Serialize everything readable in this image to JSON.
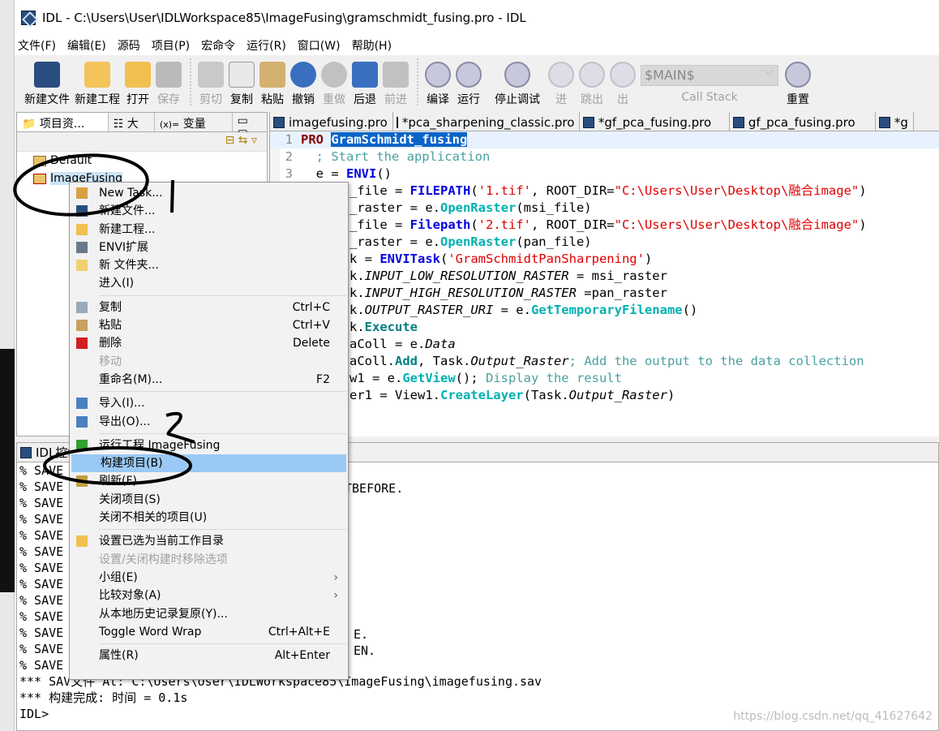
{
  "window": {
    "title": "IDL  -  C:\\Users\\User\\IDLWorkspace85\\ImageFusing\\gramschmidt_fusing.pro  -  IDL"
  },
  "menubar": [
    "文件(F)",
    "编辑(E)",
    "源码",
    "项目(P)",
    "宏命令",
    "运行(R)",
    "窗口(W)",
    "帮助(H)"
  ],
  "toolbar": {
    "new_file": "新建文件",
    "new_project": "新建工程",
    "open": "打开",
    "save": "保存",
    "cut": "剪切",
    "copy": "复制",
    "paste": "粘贴",
    "undo": "撤销",
    "redo": "重做",
    "back": "后退",
    "forward": "前进",
    "compile": "编译",
    "run": "运行",
    "stop_debug": "停止调试",
    "step_into": "进",
    "step_over": "跳出",
    "step_out": "出",
    "call_stack_value": "$MAIN$",
    "call_stack_label": "Call Stack",
    "reset": "重置"
  },
  "left_panel": {
    "tabs": [
      "项目资...",
      "大纲",
      "变量查..."
    ],
    "tree": [
      "Default",
      "ImageFusing"
    ]
  },
  "editor": {
    "tabs": [
      "imagefusing.pro",
      "*pca_sharpening_classic.pro",
      "*gf_pca_fusing.pro",
      "gf_pca_fusing.pro",
      "*g"
    ],
    "line_numbers": [
      "1",
      "2",
      "3"
    ],
    "code": {
      "l1a": "PRO ",
      "l1b": "GramSchmidt_fusing",
      "l2": "  ; Start the application",
      "l3a": "  e = ",
      "l3b": "ENVI",
      "l3c": "()",
      "l4a": "_file = ",
      "l4b": "FILEPATH",
      "l4c": "(",
      "l4d": "'1.tif'",
      "l4e": ", ROOT_DIR=",
      "l4f": "\"C:\\Users\\User\\Desktop\\融合image\"",
      "l4g": ")",
      "l5a": "_raster = e.",
      "l5b": "OpenRaster",
      "l5c": "(msi_file)",
      "l6a": "_file = ",
      "l6b": "Filepath",
      "l6c": "(",
      "l6d": "'2.tif'",
      "l6e": ", ROOT_DIR=",
      "l6f": "\"C:\\Users\\User\\Desktop\\融合image\"",
      "l6g": ")",
      "l7a": "_raster = e.",
      "l7b": "OpenRaster",
      "l7c": "(pan_file)",
      "l8a": "k = ",
      "l8b": "ENVITask",
      "l8c": "(",
      "l8d": "'GramSchmidtPanSharpening'",
      "l8e": ")",
      "l9a": "k.",
      "l9b": "INPUT_LOW_RESOLUTION_RASTER",
      "l9c": " = msi_raster",
      "l10a": "k.",
      "l10b": "INPUT_HIGH_RESOLUTION_RASTER",
      "l10c": " =pan_raster",
      "l11a": "k.",
      "l11b": "OUTPUT_RASTER_URI",
      "l11c": " = e.",
      "l11d": "GetTemporaryFilename",
      "l11e": "()",
      "l12a": "k.",
      "l12b": "Execute",
      "l13a": "aColl = e.",
      "l13b": "Data",
      "l14a": "aColl.",
      "l14b": "Add",
      "l14c": ", Task.",
      "l14d": "Output_Raster",
      "l14e": "; Add the output to the data collection",
      "l15a": "w1 = e.",
      "l15b": "GetView",
      "l15c": "(); ",
      "l15d": "Display the result",
      "l16a": "er1 = View1.",
      "l16b": "CreateLayer",
      "l16c": "(Task.",
      "l16d": "Output_Raster",
      "l16e": ")"
    }
  },
  "console": {
    "tab": "IDL控制台",
    "lines": [
      "% SAVE",
      "% SAVE",
      "% SAVE",
      "% SAVE",
      "% SAVE",
      "% SAVE",
      "% SAVE",
      "% SAVE",
      "% SAVE",
      "% SAVE",
      "% SAVE",
      "% SAVE",
      "% SAVE",
      "*** SAV文件 At: C:\\Users\\User\\IDLWorkspace85\\ImageFusing\\imagefusing.sav",
      "*** 构建完成: 时间 = 0.1s",
      "IDL>"
    ],
    "fragments": {
      "f1": "TBEFORE.",
      "f2": "E.",
      "f3": "EN."
    }
  },
  "context_menu": {
    "items": [
      {
        "label": "New Task...",
        "icon": "new-task-icon"
      },
      {
        "label": "新建文件...",
        "icon": "idl-file-icon"
      },
      {
        "label": "新建工程...",
        "icon": "new-project-icon"
      },
      {
        "label": "ENVI扩展",
        "icon": "envi-extension-icon"
      },
      {
        "label": "新 文件夹...",
        "icon": "new-folder-icon"
      },
      {
        "label": "进入(I)"
      },
      {
        "label": "复制",
        "shortcut": "Ctrl+C",
        "icon": "copy-icon"
      },
      {
        "label": "粘贴",
        "shortcut": "Ctrl+V",
        "icon": "paste-icon"
      },
      {
        "label": "删除",
        "shortcut": "Delete",
        "icon": "delete-icon"
      },
      {
        "label": "移动",
        "disabled": true
      },
      {
        "label": "重命名(M)...",
        "shortcut": "F2"
      },
      {
        "label": "导入(I)...",
        "icon": "import-icon"
      },
      {
        "label": "导出(O)...",
        "icon": "export-icon"
      },
      {
        "label": "运行工程 ImageFusing",
        "icon": "run-icon"
      },
      {
        "label": "构建项目(B)",
        "selected": true
      },
      {
        "label": "刷新(F)",
        "icon": "refresh-icon"
      },
      {
        "label": "关闭项目(S)"
      },
      {
        "label": "关闭不相关的项目(U)"
      },
      {
        "label": "设置已选为当前工作目录",
        "icon": "folder-open-icon"
      },
      {
        "label": "设置/关闭构建时移除选项",
        "disabled": true
      },
      {
        "label": "小组(E)",
        "submenu": true
      },
      {
        "label": "比较对象(A)",
        "submenu": true
      },
      {
        "label": "从本地历史记录复原(Y)..."
      },
      {
        "label": "Toggle Word Wrap",
        "shortcut": "Ctrl+Alt+E"
      },
      {
        "label": "属性(R)",
        "shortcut": "Alt+Enter"
      }
    ]
  },
  "annotations": {
    "mark1": "1",
    "mark2": "2"
  },
  "watermark": "https://blog.csdn.net/qq_41627642",
  "colors": {
    "selection": "#99c9f4",
    "keyword": "#8b0000",
    "function": "#0000e0",
    "method": "#00b0b0",
    "string": "#e00000"
  }
}
